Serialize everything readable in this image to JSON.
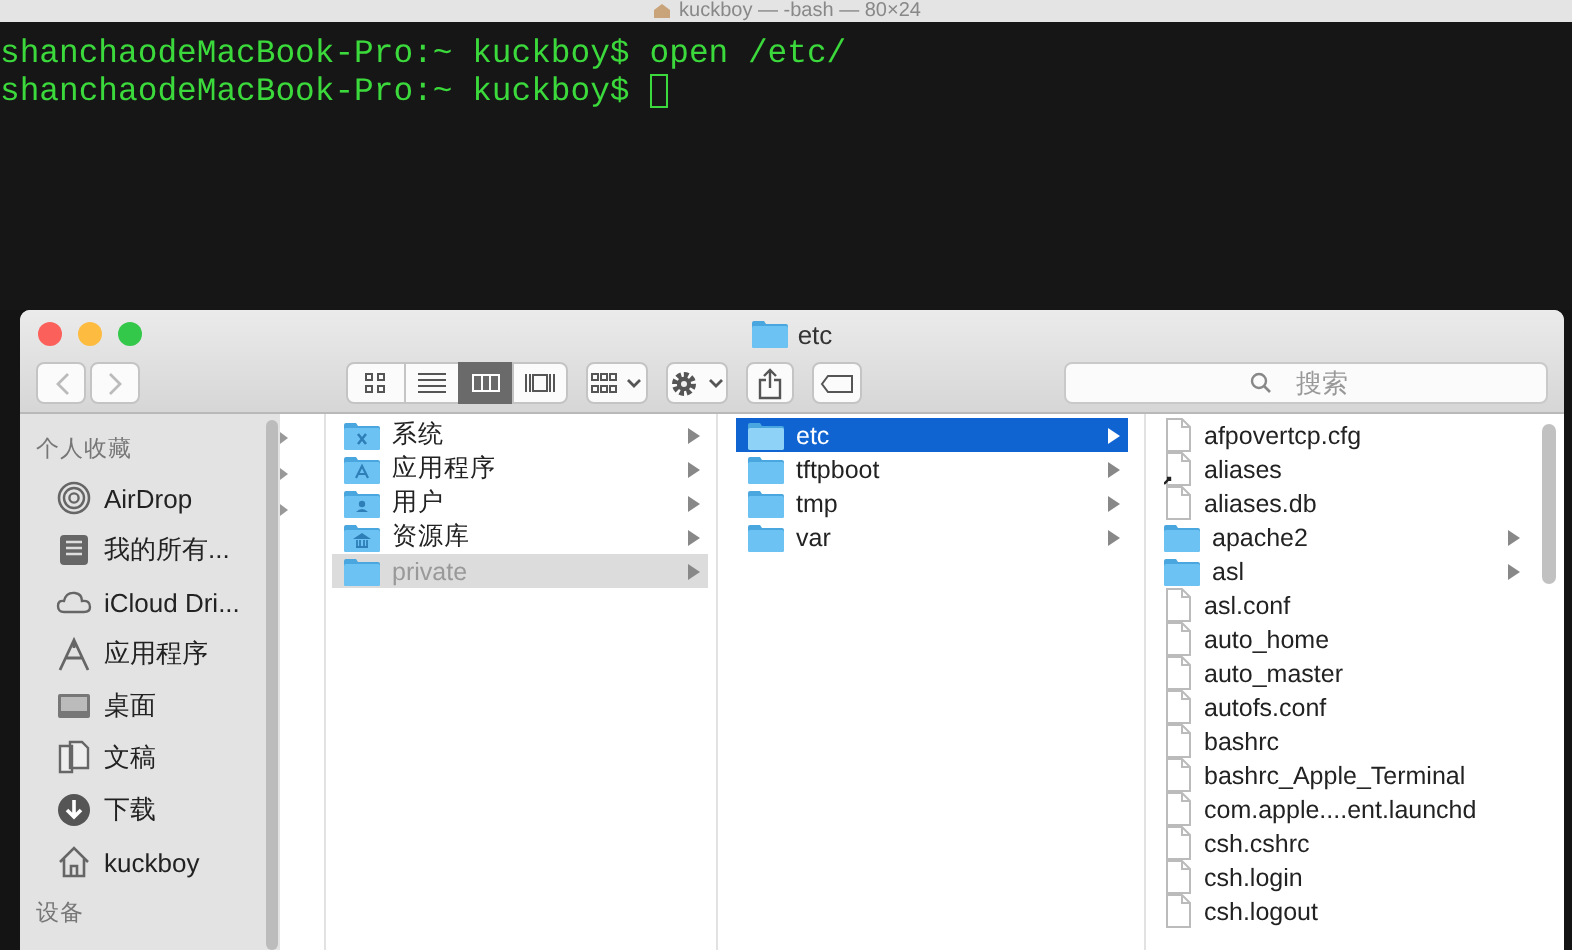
{
  "terminal": {
    "title": "kuckboy — -bash — 80×24",
    "lines": [
      {
        "prompt": "shanchaodeMacBook-Pro:~ kuckboy$",
        "command": "open /etc/"
      },
      {
        "prompt": "shanchaodeMacBook-Pro:~ kuckboy$"
      }
    ],
    "cursor": true
  },
  "finder": {
    "title": "etc",
    "view_modes": [
      {
        "kind": "icons",
        "selected": false
      },
      {
        "kind": "list",
        "selected": false
      },
      {
        "kind": "columns",
        "selected": true
      },
      {
        "kind": "gallery",
        "selected": false
      }
    ],
    "search": {
      "placeholder": "搜索"
    },
    "sidebar": {
      "sections": [
        {
          "title": "个人收藏",
          "items": [
            {
              "kind": "airdrop",
              "label": "AirDrop",
              "selected": false
            },
            {
              "kind": "all-files",
              "label": "我的所有...",
              "selected": false
            },
            {
              "kind": "icloud",
              "label": "iCloud Dri...",
              "selected": false
            },
            {
              "kind": "apps",
              "label": "应用程序",
              "selected": false
            },
            {
              "kind": "desktop",
              "label": "桌面",
              "selected": false
            },
            {
              "kind": "documents",
              "label": "文稿",
              "selected": false
            },
            {
              "kind": "downloads",
              "label": "下载",
              "selected": false
            },
            {
              "kind": "home",
              "label": "kuckboy",
              "selected": false
            }
          ]
        },
        {
          "title": "设备"
        }
      ]
    },
    "columns": [
      {
        "items": [
          {
            "kind": "system",
            "name": "系统",
            "hidden": false,
            "selected": false
          },
          {
            "kind": "apps",
            "name": "应用程序",
            "hidden": false,
            "selected": false
          },
          {
            "kind": "users",
            "name": "用户",
            "hidden": false,
            "selected": false
          },
          {
            "kind": "library",
            "name": "资源库",
            "hidden": false,
            "selected": false
          },
          {
            "kind": "folder",
            "name": "private",
            "hidden": true,
            "selected": true
          }
        ]
      },
      {
        "items": [
          {
            "kind": "folder",
            "name": "etc",
            "hidden": false,
            "selected": true
          },
          {
            "kind": "folder",
            "name": "tftpboot",
            "hidden": false,
            "selected": false
          },
          {
            "kind": "folder",
            "name": "tmp",
            "hidden": false,
            "selected": false
          },
          {
            "kind": "folder",
            "name": "var",
            "hidden": false,
            "selected": false
          }
        ]
      },
      {
        "items": [
          {
            "kind": "file",
            "name": "afpovertcp.cfg",
            "hidden": false,
            "selected": false
          },
          {
            "kind": "alias",
            "name": "aliases",
            "hidden": false,
            "selected": false
          },
          {
            "kind": "file",
            "name": "aliases.db",
            "hidden": false,
            "selected": false
          },
          {
            "kind": "folder",
            "name": "apache2",
            "hidden": false,
            "selected": false
          },
          {
            "kind": "folder",
            "name": "asl",
            "hidden": false,
            "selected": false
          },
          {
            "kind": "file",
            "name": "asl.conf",
            "hidden": false,
            "selected": false
          },
          {
            "kind": "file",
            "name": "auto_home",
            "hidden": false,
            "selected": false
          },
          {
            "kind": "file",
            "name": "auto_master",
            "hidden": false,
            "selected": false
          },
          {
            "kind": "file",
            "name": "autofs.conf",
            "hidden": false,
            "selected": false
          },
          {
            "kind": "file",
            "name": "bashrc",
            "hidden": false,
            "selected": false
          },
          {
            "kind": "file",
            "name": "bashrc_Apple_Terminal",
            "hidden": false,
            "selected": false
          },
          {
            "kind": "file",
            "name": "com.apple....ent.launchd",
            "hidden": false,
            "selected": false
          },
          {
            "kind": "file",
            "name": "csh.cshrc",
            "hidden": false,
            "selected": false
          },
          {
            "kind": "file",
            "name": "csh.login",
            "hidden": false,
            "selected": false
          },
          {
            "kind": "file",
            "name": "csh.logout",
            "hidden": false,
            "selected": false
          }
        ]
      }
    ]
  }
}
